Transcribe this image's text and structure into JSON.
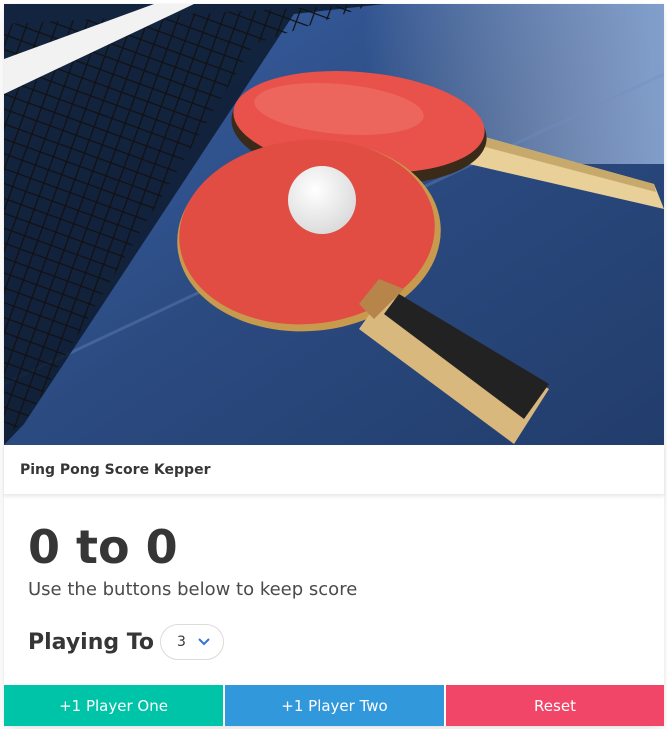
{
  "card": {
    "header_title": "Ping Pong Score Kepper",
    "score": {
      "player_one": 0,
      "player_two": 0,
      "separator": "to",
      "display": "0 to 0"
    },
    "subtitle": "Use the buttons below to keep score",
    "playing_to": {
      "label": "Playing To",
      "selected": "3"
    },
    "buttons": {
      "player_one": "+1 Player One",
      "player_two": "+1 Player Two",
      "reset": "Reset"
    }
  },
  "colors": {
    "player_one": "#00c4a7",
    "player_two": "#3298dc",
    "reset": "#f14668",
    "chevron": "#3273dc",
    "table": "#2d4f86",
    "paddle": "#e8524a"
  },
  "icons": {
    "select_arrow": "chevron-down-icon"
  }
}
